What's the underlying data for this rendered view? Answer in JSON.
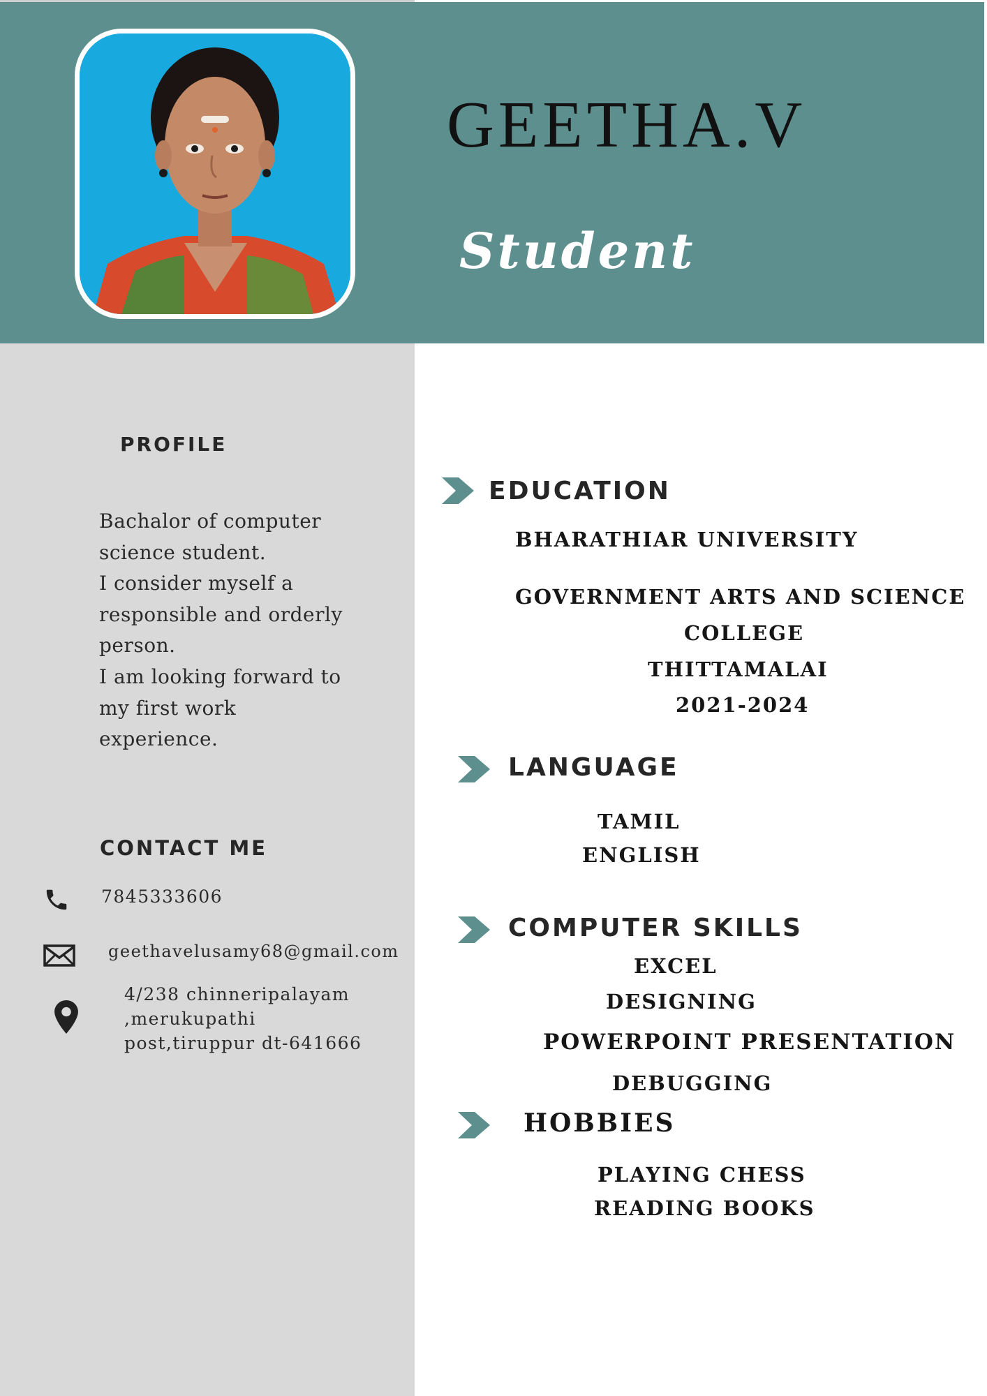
{
  "header": {
    "name": "GEETHA.V",
    "role": "Student",
    "band_color": "#5d8f8e"
  },
  "sidebar": {
    "background": "#d9d9d9",
    "profile": {
      "heading": "PROFILE",
      "lines": [
        "Bachalor of computer",
        "science student.",
        "I consider myself a",
        "responsible and orderly",
        "person.",
        "I am looking forward to",
        "my first work",
        "experience."
      ]
    },
    "contact": {
      "heading": "CONTACT ME",
      "phone": "7845333606",
      "email": "geethavelusamy68@gmail.com",
      "address_lines": [
        "4/238 chinneripalayam",
        ",merukupathi",
        "post,tiruppur dt-641666"
      ],
      "icons": [
        "phone-icon",
        "mail-icon",
        "location-pin-icon"
      ]
    }
  },
  "main": {
    "education": {
      "heading": "EDUCATION",
      "university": "BHARATHIAR UNIVERSITY",
      "college_lines": [
        "GOVERNMENT ARTS AND SCIENCE",
        "COLLEGE",
        "THITTAMALAI",
        "2021-2024"
      ]
    },
    "language": {
      "heading": "LANGUAGE",
      "items": [
        "TAMIL",
        "ENGLISH"
      ]
    },
    "computer_skills": {
      "heading": "COMPUTER SKILLS",
      "items": [
        "EXCEL",
        "DESIGNING",
        "POWERPOINT PRESENTATION",
        "DEBUGGING"
      ]
    },
    "hobbies": {
      "heading": "HOBBIES",
      "items": [
        "PLAYING CHESS",
        "READING BOOKS"
      ]
    },
    "bullet_icon": "chevron-right-icon",
    "accent_color": "#5d8f8e"
  }
}
